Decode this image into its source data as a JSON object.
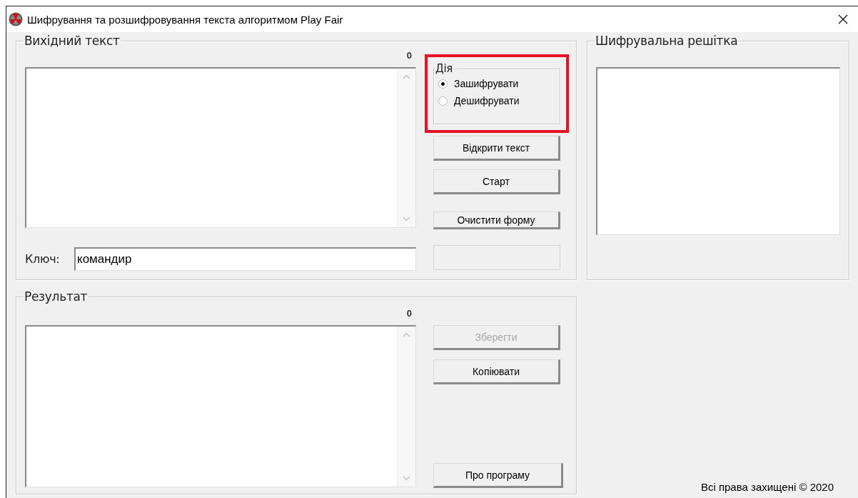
{
  "window": {
    "title": "Шифрування та розшифровування текста алгоритмом Play Fair"
  },
  "source": {
    "title": "Вихідний текст",
    "count": "0"
  },
  "action": {
    "title": "Дія",
    "options": [
      {
        "label": "Зашифрувати",
        "selected": true
      },
      {
        "label": "Дешифрувати",
        "selected": false
      }
    ]
  },
  "buttons": [
    {
      "label": "Відкрити текст",
      "disabled": false
    },
    {
      "label": "Старт",
      "disabled": false
    },
    {
      "label": "Очистити форму",
      "disabled": false
    }
  ],
  "key": {
    "label": "Ключ:",
    "value": "командир"
  },
  "grid": {
    "title": "Шифрувальна решітка"
  },
  "result": {
    "title": "Результат",
    "count": "0",
    "buttons": [
      {
        "label": "Зберегти",
        "disabled": true
      },
      {
        "label": "Копіювати",
        "disabled": false
      },
      {
        "label": "Про програму",
        "disabled": false
      }
    ]
  },
  "footer": "Всі права захищені © 2020"
}
